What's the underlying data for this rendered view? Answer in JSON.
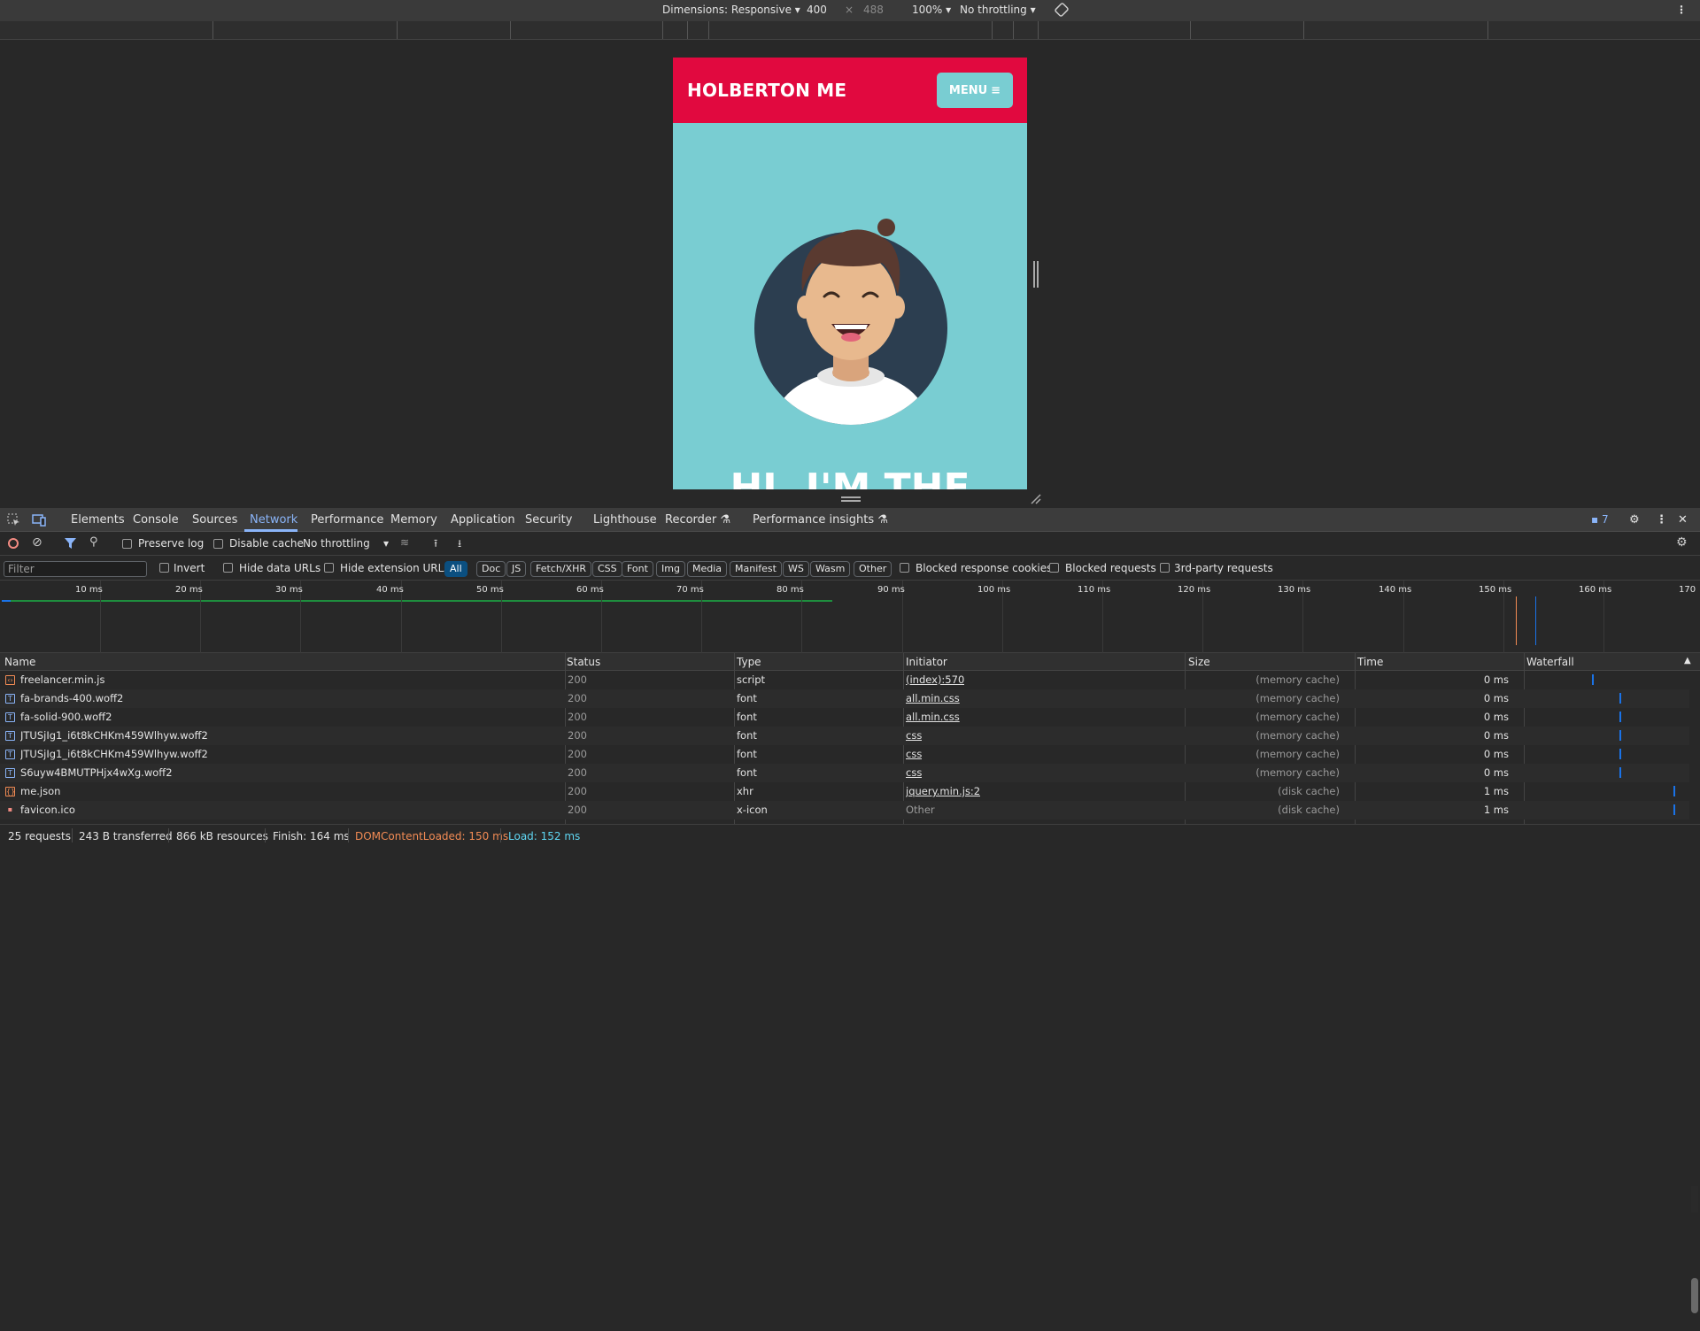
{
  "device_toolbar": {
    "dimensions_label": "Dimensions: Responsive",
    "width": "400",
    "times": "×",
    "height": "488",
    "zoom": "100%",
    "throttling": "No throttling"
  },
  "site": {
    "brand": "HOLBERTON ME",
    "menu_label": "MENU",
    "hero_text": "HI, I'M THE"
  },
  "devtools": {
    "tabs": [
      "Elements",
      "Console",
      "Sources",
      "Network",
      "Performance",
      "Memory",
      "Application",
      "Security",
      "Lighthouse",
      "Recorder",
      "Performance insights"
    ],
    "active_tab": "Network",
    "issues_count": "7",
    "toolbar": {
      "preserve_log": "Preserve log",
      "disable_cache": "Disable cache",
      "throttling": "No throttling"
    },
    "filter": {
      "placeholder": "Filter",
      "invert": "Invert",
      "hide_data_urls": "Hide data URLs",
      "hide_extension_urls": "Hide extension URLs",
      "types": [
        "All",
        "Doc",
        "JS",
        "Fetch/XHR",
        "CSS",
        "Font",
        "Img",
        "Media",
        "Manifest",
        "WS",
        "Wasm",
        "Other"
      ],
      "blocked_response_cookies": "Blocked response cookies",
      "blocked_requests": "Blocked requests",
      "third_party": "3rd-party requests"
    },
    "overview_ticks": [
      "10 ms",
      "20 ms",
      "30 ms",
      "40 ms",
      "50 ms",
      "60 ms",
      "70 ms",
      "80 ms",
      "90 ms",
      "100 ms",
      "110 ms",
      "120 ms",
      "130 ms",
      "140 ms",
      "150 ms",
      "160 ms",
      "170"
    ],
    "columns": [
      "Name",
      "Status",
      "Type",
      "Initiator",
      "Size",
      "Time",
      "Waterfall"
    ],
    "requests": [
      {
        "name": "freelancer.min.js",
        "status": "200",
        "type": "script",
        "initiator": "(index):570",
        "size": "(memory cache)",
        "time": "0 ms",
        "icon": "script-file-icon",
        "wf": 0.42
      },
      {
        "name": "fa-brands-400.woff2",
        "status": "200",
        "type": "font",
        "initiator": "all.min.css",
        "size": "(memory cache)",
        "time": "0 ms",
        "icon": "font-file-icon",
        "wf": 0.6
      },
      {
        "name": "fa-solid-900.woff2",
        "status": "200",
        "type": "font",
        "initiator": "all.min.css",
        "size": "(memory cache)",
        "time": "0 ms",
        "icon": "font-file-icon",
        "wf": 0.6
      },
      {
        "name": "JTUSjIg1_i6t8kCHKm459Wlhyw.woff2",
        "status": "200",
        "type": "font",
        "initiator": "css",
        "size": "(memory cache)",
        "time": "0 ms",
        "icon": "font-file-icon",
        "wf": 0.6
      },
      {
        "name": "JTUSjIg1_i6t8kCHKm459Wlhyw.woff2",
        "status": "200",
        "type": "font",
        "initiator": "css",
        "size": "(memory cache)",
        "time": "0 ms",
        "icon": "font-file-icon",
        "wf": 0.6
      },
      {
        "name": "S6uyw4BMUTPHjx4wXg.woff2",
        "status": "200",
        "type": "font",
        "initiator": "css",
        "size": "(memory cache)",
        "time": "0 ms",
        "icon": "font-file-icon",
        "wf": 0.6
      },
      {
        "name": "me.json",
        "status": "200",
        "type": "xhr",
        "initiator": "jquery.min.js:2",
        "size": "(disk cache)",
        "time": "1 ms",
        "icon": "json-file-icon",
        "wf": 0.95
      },
      {
        "name": "favicon.ico",
        "status": "200",
        "type": "x-icon",
        "initiator": "Other",
        "size": "(disk cache)",
        "time": "1 ms",
        "icon": "image-file-icon",
        "wf": 0.95
      }
    ],
    "status_bar": {
      "requests": "25 requests",
      "transferred": "243 B transferred",
      "resources": "866 kB resources",
      "finish": "Finish: 164 ms",
      "dom_content_loaded": "DOMContentLoaded: 150 ms",
      "load": "Load: 152 ms"
    },
    "colors": {
      "accent": "#8ab4f8",
      "dcl": "#f28b54",
      "load": "#5fd6f2",
      "brand_red": "#e1093f",
      "teal": "#79cdd2"
    }
  }
}
